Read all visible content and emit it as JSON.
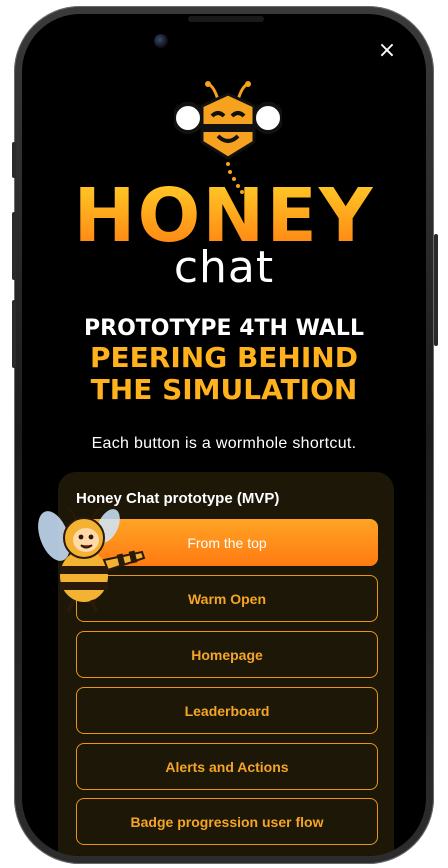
{
  "brand": {
    "name_primary": "HONEY",
    "name_secondary": "chat"
  },
  "headline": "PROTOTYPE 4TH WALL",
  "subheadline_line1": "PEERING BEHIND",
  "subheadline_line2": "THE SIMULATION",
  "tagline": "Each button is a wormhole shortcut.",
  "card": {
    "title": "Honey Chat prototype (MVP)",
    "buttons": [
      {
        "label": "From the top",
        "style": "primary"
      },
      {
        "label": "Warm Open",
        "style": "outline"
      },
      {
        "label": "Homepage",
        "style": "outline"
      },
      {
        "label": "Leaderboard",
        "style": "outline"
      },
      {
        "label": "Alerts and Actions",
        "style": "outline"
      },
      {
        "label": "Badge progression user flow",
        "style": "outline"
      }
    ]
  },
  "close_icon": "×",
  "colors": {
    "accent": "#ffa21a",
    "accent_dark": "#ff7a12",
    "card_bg": "#1d1708",
    "screen_bg": "#000000"
  }
}
